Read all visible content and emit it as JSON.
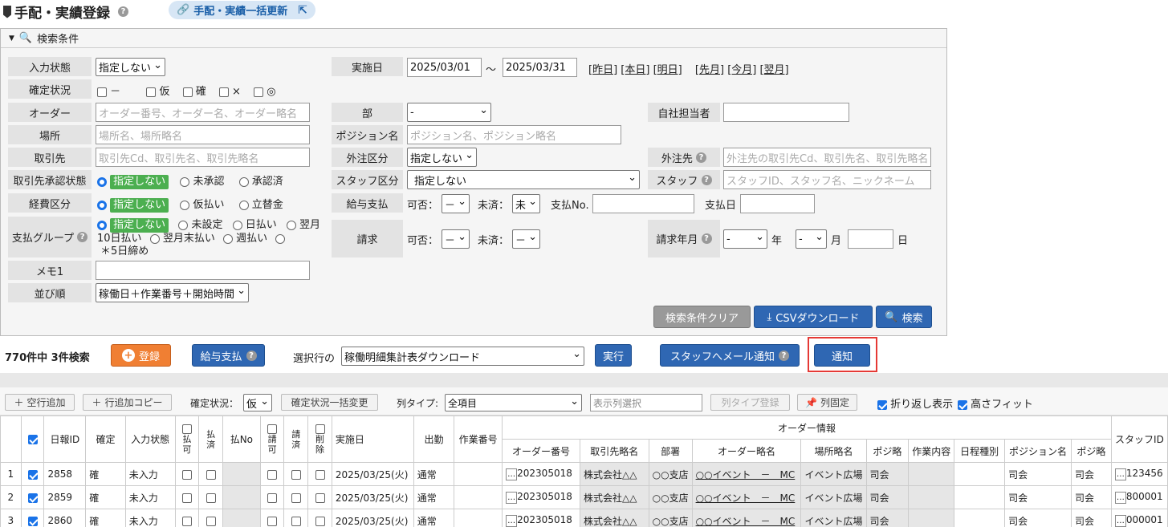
{
  "page": {
    "title": "手配・実績登録",
    "bulk_update_label": "手配・実績一括更新"
  },
  "search": {
    "header": "検索条件",
    "input_state": {
      "label": "入力状態",
      "value": "指定しない"
    },
    "confirm_state": {
      "label": "確定状況",
      "options": [
        "－",
        "仮",
        "確",
        "×",
        "◎"
      ]
    },
    "order": {
      "label": "オーダー",
      "placeholder": "オーダー番号、オーダー名、オーダー略名"
    },
    "place": {
      "label": "場所",
      "placeholder": "場所名、場所略名"
    },
    "client": {
      "label": "取引先",
      "placeholder": "取引先Cd、取引先名、取引先略名"
    },
    "client_approval": {
      "label": "取引先承認状態",
      "options": [
        "指定しない",
        "未承認",
        "承認済"
      ]
    },
    "expense": {
      "label": "経費区分",
      "options": [
        "指定しない",
        "仮払い",
        "立替金"
      ]
    },
    "pay_group": {
      "label": "支払グループ",
      "options": [
        "指定しない",
        "未設定",
        "日払い",
        "翌月10日払い",
        "翌月末払い",
        "週払い",
        "＊5日締め"
      ]
    },
    "memo": {
      "label": "メモ1",
      "value": ""
    },
    "sort": {
      "label": "並び順",
      "value": "稼働日＋作業番号＋開始時間"
    },
    "date": {
      "label": "実施日",
      "from": "2025/03/01",
      "sep": "～",
      "to": "2025/03/31",
      "links": [
        "[昨日]",
        "[本日]",
        "[明日]",
        "[先月]",
        "[今月]",
        "[翌月]"
      ]
    },
    "dept": {
      "label": "部",
      "value": "-"
    },
    "position": {
      "label": "ポジション名",
      "placeholder": "ポジション名、ポジション略名"
    },
    "outsource_type": {
      "label": "外注区分",
      "value": "指定しない"
    },
    "staff_type": {
      "label": "スタッフ区分",
      "value": "指定しない"
    },
    "salary": {
      "label": "給与支払",
      "ok_label": "可否：",
      "ok_value": "－",
      "unpaid_label": "未済：",
      "unpaid_value": "未",
      "payno_label": "支払No.",
      "paydate_label": "支払日"
    },
    "billing": {
      "label": "請求",
      "ok_label": "可否：",
      "ok_value": "－",
      "unpaid_label": "未済：",
      "unpaid_value": "－"
    },
    "own_staff": {
      "label": "自社担当者",
      "value": ""
    },
    "outsource": {
      "label": "外注先",
      "placeholder": "外注先の取引先Cd、取引先名、取引先略名"
    },
    "staff": {
      "label": "スタッフ",
      "placeholder": "スタッフID、スタッフ名、ニックネーム"
    },
    "bill_month": {
      "label": "請求年月",
      "year_value": "-",
      "year_unit": "年",
      "month_value": "-",
      "month_unit": "月",
      "day_unit": "日"
    },
    "clear_label": "検索条件クリア",
    "csv_label": "CSVダウンロード",
    "search_label": "検索"
  },
  "actions": {
    "count_text": "770件中 3件検索",
    "register_label": "登録",
    "salary_label": "給与支払",
    "selected_label": "選択行の",
    "selected_value": "稼働明細集計表ダウンロード",
    "execute_label": "実行",
    "staff_mail_label": "スタッフへメール通知",
    "notify_label": "通知"
  },
  "toolbar": {
    "add_row": "空行追加",
    "copy_row": "行追加コピー",
    "confirm_label": "確定状況：",
    "confirm_value": "仮",
    "confirm_bulk": "確定状況一括変更",
    "coltype_label": "列タイプ:",
    "coltype_value": "全項目",
    "colselect_placeholder": "表示列選択",
    "coltype_register": "列タイプ登録",
    "col_fix": "列固定",
    "wrap_label": "折り返し表示",
    "fit_label": "高さフィット"
  },
  "grid": {
    "group_header": "オーダー情報",
    "headers": [
      "日報ID",
      "確定",
      "入力状態",
      "払可",
      "払済",
      "払No",
      "請可",
      "請済",
      "削除",
      "実施日",
      "出勤",
      "作業番号",
      "オーダー番号",
      "取引先略名",
      "部署",
      "オーダー略名",
      "場所略名",
      "ポジ略",
      "作業内容",
      "日程種別",
      "ポジション名",
      "ポジ略",
      "スタッフID"
    ],
    "rows": [
      {
        "no": "1",
        "id": "2858",
        "confirm": "確",
        "state": "未入力",
        "date": "2025/03/25(火)",
        "attend": "通常",
        "order_no": "202305018",
        "client": "株式会社△△",
        "dept": "○○支店",
        "order_name": "○○イベント　－　MC",
        "place": "イベント広場",
        "pos_short": "司会",
        "pos_name": "司会",
        "pos_short2": "司会",
        "staff_id": "123456"
      },
      {
        "no": "2",
        "id": "2859",
        "confirm": "確",
        "state": "未入力",
        "date": "2025/03/25(火)",
        "attend": "通常",
        "order_no": "202305018",
        "client": "株式会社△△",
        "dept": "○○支店",
        "order_name": "○○イベント　－　MC",
        "place": "イベント広場",
        "pos_short": "司会",
        "pos_name": "司会",
        "pos_short2": "司会",
        "staff_id": "800001"
      },
      {
        "no": "3",
        "id": "2860",
        "confirm": "確",
        "state": "未入力",
        "date": "2025/03/25(火)",
        "attend": "通常",
        "order_no": "202305018",
        "client": "株式会社△△",
        "dept": "○○支店",
        "order_name": "○○イベント　－　MC",
        "place": "イベント広場",
        "pos_short": "司会",
        "pos_name": "司会",
        "pos_short2": "司会",
        "staff_id": "000001"
      }
    ]
  },
  "colors": {
    "accent": "#2f67b3",
    "highlight": "#e53935",
    "green": "#4caf50",
    "orange": "#f07f33"
  }
}
